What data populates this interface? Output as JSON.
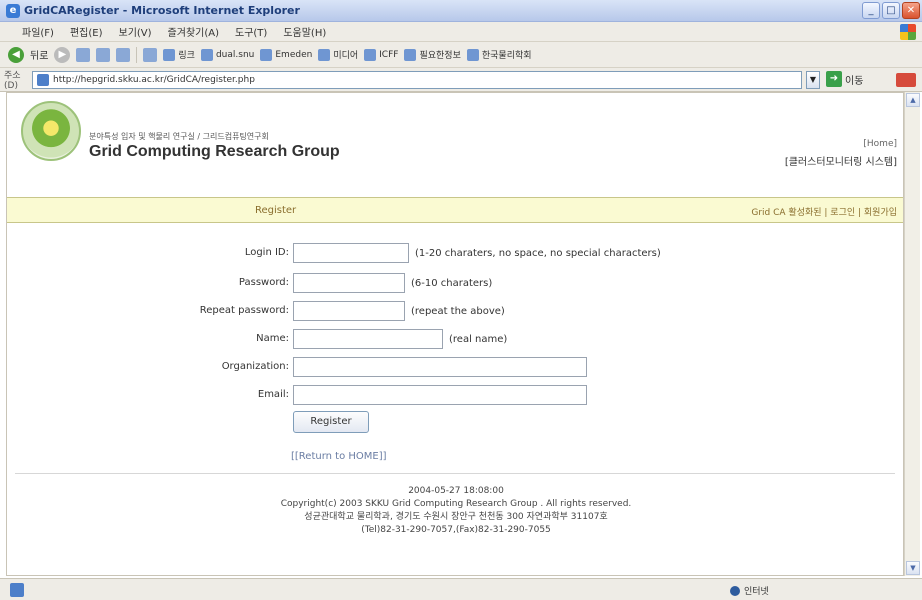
{
  "window": {
    "title": "GridCARegister - Microsoft Internet Explorer",
    "minimize": "_",
    "maximize": "□",
    "close": "✕"
  },
  "menu": [
    "파일(F)",
    "편집(E)",
    "보기(V)",
    "즐겨찾기(A)",
    "도구(T)",
    "도움말(H)"
  ],
  "toolbar": {
    "back": "뒤로",
    "links": [
      "링크",
      "dual.snu",
      "Emeden",
      "미디어",
      "ICFF",
      "필요한정보",
      "한국물리학회"
    ]
  },
  "address": {
    "label": "주소(D)",
    "url": "http://hepgrid.skku.ac.kr/GridCA/register.php",
    "go": "이동"
  },
  "site": {
    "subtitle": "분야특성 입자 및 핵물리 연구실 / 그리드컴퓨팅연구회",
    "title": "Grid Computing Research Group",
    "home": "[Home]",
    "cluster": "[클러스터모니터링 시스템]"
  },
  "nav": {
    "current": "Register",
    "links": "Grid CA 활성화된 | 로그인 | 회원가입"
  },
  "form": {
    "login_label": "Login ID:",
    "login_hint": "(1-20 charaters, no space, no special characters)",
    "password_label": "Password:",
    "password_hint": "(6-10 charaters)",
    "repeat_label": "Repeat password:",
    "repeat_hint": "(repeat the above)",
    "name_label": "Name:",
    "name_hint": "(real name)",
    "org_label": "Organization:",
    "email_label": "Email:",
    "register_button": "Register",
    "return_link": "[[Return to HOME]]"
  },
  "footer": {
    "timestamp": "2004-05-27 18:08:00",
    "copyright": "Copyright(c) 2003 SKKU Grid Computing Research Group . All rights reserved.",
    "address": "성균관대학교 물리학과, 경기도 수원시 장안구 천천동 300 자연과학부 31107호",
    "contact": "(Tel)82-31-290-7057,(Fax)82-31-290-7055"
  },
  "status": {
    "zone": "인터넷"
  }
}
